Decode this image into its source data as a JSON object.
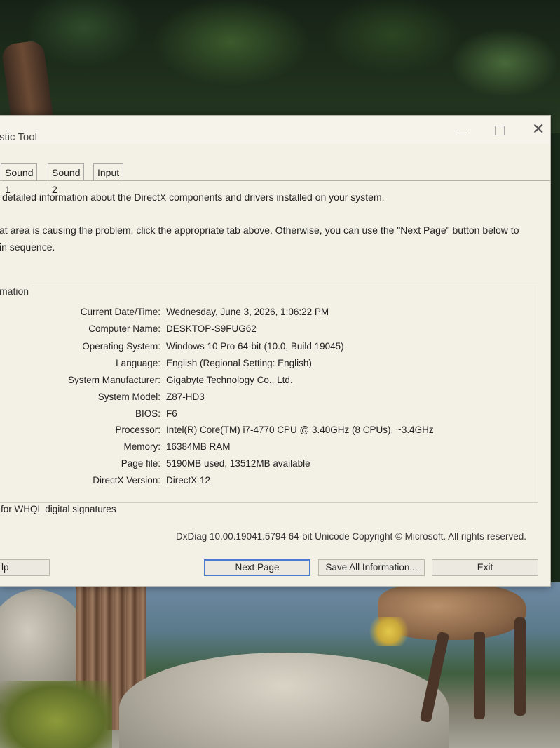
{
  "window": {
    "title": "stic Tool",
    "controls": {
      "minimize": "–",
      "close": "✕"
    }
  },
  "tabs": [
    {
      "label": "Sound 1"
    },
    {
      "label": "Sound 2"
    },
    {
      "label": "Input"
    }
  ],
  "description": {
    "line1": "detailed information about the DirectX components and drivers installed on your system.",
    "line2": "at area is causing the problem, click the appropriate tab above.  Otherwise, you can use the \"Next Page\" button below to",
    "line3": "in sequence."
  },
  "system_information": {
    "legend": "mation",
    "rows": [
      {
        "label": "Current Date/Time:",
        "value": "Wednesday, June 3, 2026, 1:06:22 PM"
      },
      {
        "label": "Computer Name:",
        "value": "DESKTOP-S9FUG62"
      },
      {
        "label": "Operating System:",
        "value": "Windows 10 Pro 64-bit (10.0, Build 19045)"
      },
      {
        "label": "Language:",
        "value": "English (Regional Setting: English)"
      },
      {
        "label": "System Manufacturer:",
        "value": "Gigabyte Technology Co., Ltd."
      },
      {
        "label": "System Model:",
        "value": "Z87-HD3"
      },
      {
        "label": "BIOS:",
        "value": "F6"
      },
      {
        "label": "Processor:",
        "value": "Intel(R) Core(TM) i7-4770 CPU @ 3.40GHz (8 CPUs), ~3.4GHz"
      },
      {
        "label": "Memory:",
        "value": "16384MB RAM"
      },
      {
        "label": "Page file:",
        "value": "5190MB used, 13512MB available"
      },
      {
        "label": "DirectX Version:",
        "value": "DirectX 12"
      }
    ]
  },
  "whql_text": "for WHQL digital signatures",
  "copyright": "DxDiag 10.00.19041.5794 64-bit Unicode  Copyright © Microsoft. All rights reserved.",
  "buttons": {
    "help": "lp",
    "next_page": "Next Page",
    "save_all": "Save All Information...",
    "exit": "Exit"
  }
}
